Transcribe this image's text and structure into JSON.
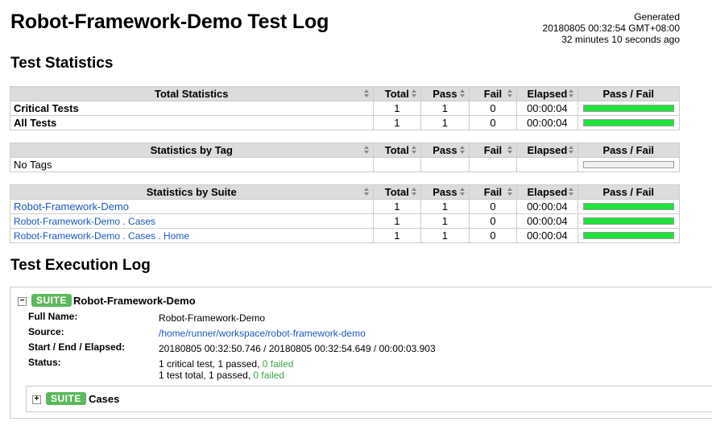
{
  "header": {
    "title": "Robot-Framework-Demo Test Log",
    "generated_label": "Generated",
    "generated_time": "20180805 00:32:54 GMT+08:00",
    "generated_ago": "32 minutes 10 seconds ago"
  },
  "test_statistics": {
    "title": "Test Statistics",
    "columns": [
      "Total",
      "Pass",
      "Fail",
      "Elapsed",
      "Pass / Fail"
    ],
    "total": {
      "header": "Total Statistics",
      "rows": [
        {
          "name": "Critical Tests",
          "total": "1",
          "pass": "1",
          "fail": "0",
          "elapsed": "00:00:04",
          "pass_ratio": 1
        },
        {
          "name": "All Tests",
          "total": "1",
          "pass": "1",
          "fail": "0",
          "elapsed": "00:00:04",
          "pass_ratio": 1
        }
      ]
    },
    "tag": {
      "header": "Statistics by Tag",
      "rows": [
        {
          "name": "No Tags",
          "total": "",
          "pass": "",
          "fail": "",
          "elapsed": "",
          "pass_ratio": 0
        }
      ]
    },
    "suite": {
      "header": "Statistics by Suite",
      "rows": [
        {
          "name": "Robot-Framework-Demo",
          "total": "1",
          "pass": "1",
          "fail": "0",
          "elapsed": "00:00:04",
          "pass_ratio": 1
        },
        {
          "name": "Robot-Framework-Demo . Cases",
          "total": "1",
          "pass": "1",
          "fail": "0",
          "elapsed": "00:00:04",
          "pass_ratio": 1
        },
        {
          "name": "Robot-Framework-Demo . Cases . Home",
          "total": "1",
          "pass": "1",
          "fail": "0",
          "elapsed": "00:00:04",
          "pass_ratio": 1
        }
      ]
    }
  },
  "execution_log": {
    "title": "Test Execution Log",
    "suite": {
      "toggle": "−",
      "badge": "SUITE",
      "name": "Robot-Framework-Demo",
      "full_name_label": "Full Name:",
      "full_name": "Robot-Framework-Demo",
      "source_label": "Source:",
      "source": "/home/runner/workspace/robot-framework-demo",
      "times_label": "Start / End / Elapsed:",
      "times": "20180805 00:32:50.746 / 20180805 00:32:54.649 / 00:00:03.903",
      "status_label": "Status:",
      "status_line1_prefix": "1 critical test, 1 passed, ",
      "status_line1_failed": "0 failed",
      "status_line2_prefix": "1 test total, 1 passed, ",
      "status_line2_failed": "0 failed"
    },
    "child": {
      "toggle": "+",
      "badge": "SUITE",
      "name": "Cases"
    }
  }
}
